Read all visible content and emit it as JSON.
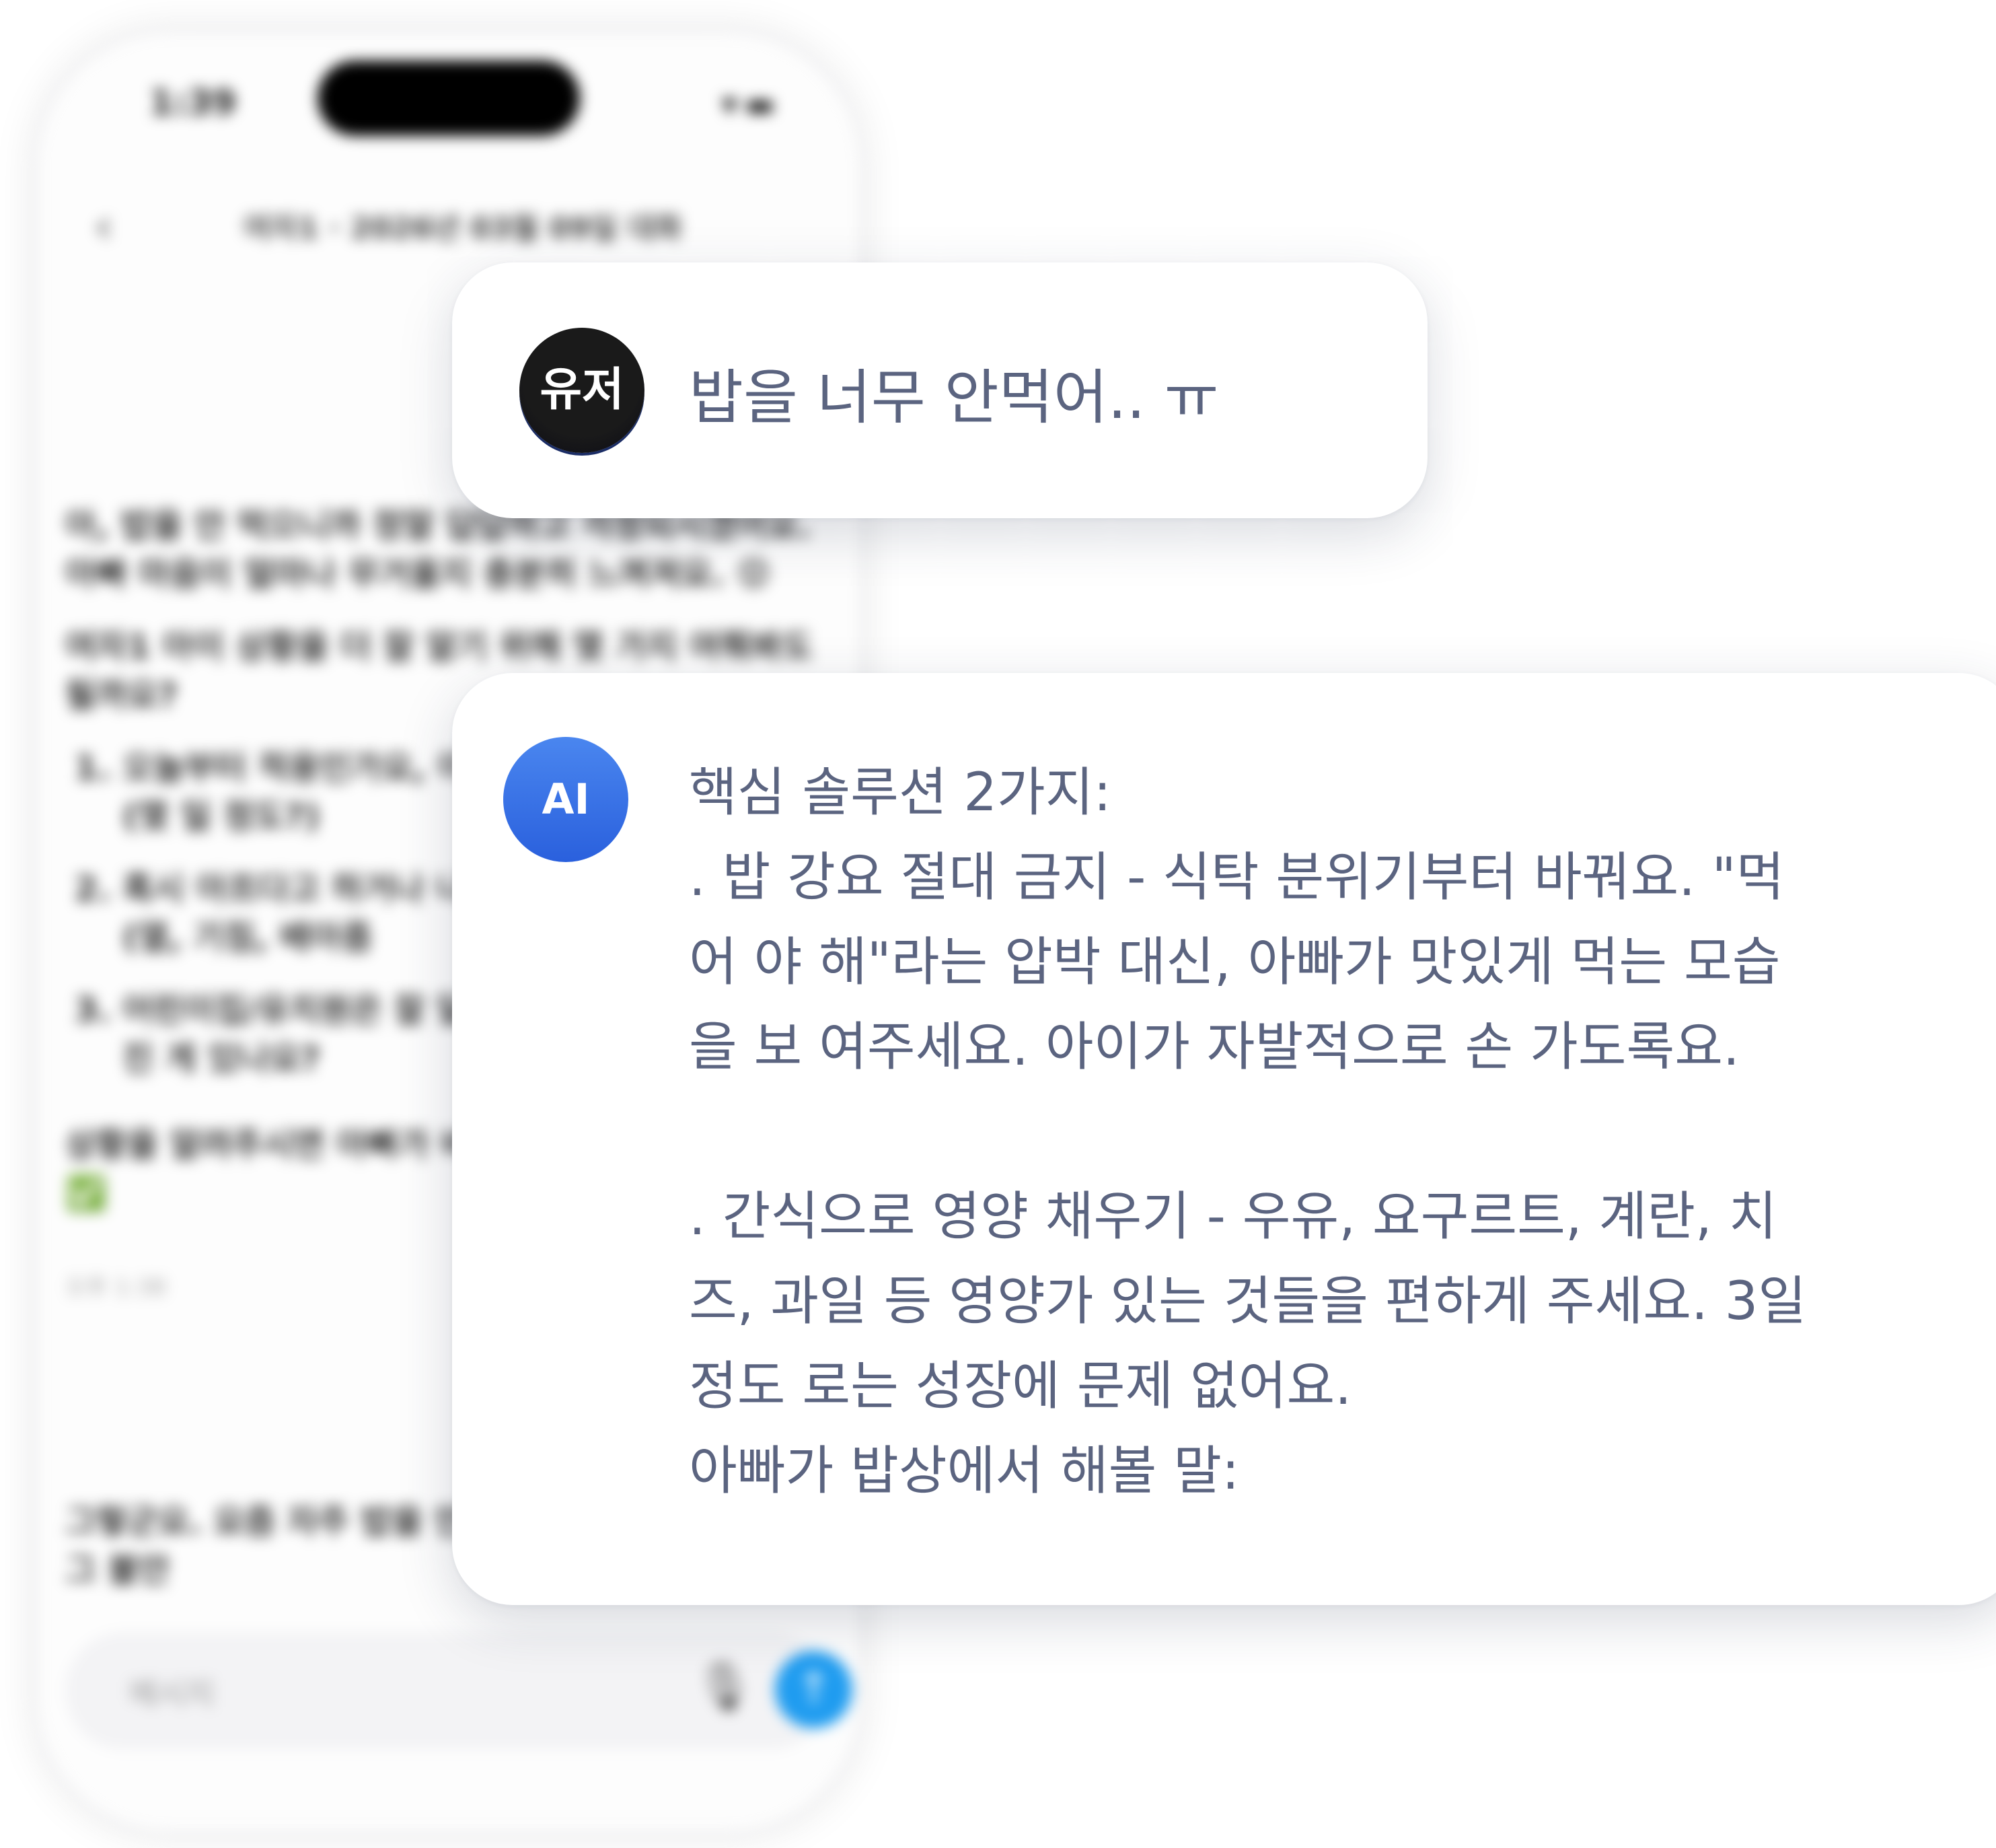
{
  "phone": {
    "status_time": "1:39",
    "chat_title": "여자1 · 2026년 03월 09일 대화",
    "bg_messages": [
      "아, 밥을 안 먹으니까 정말 답답하고 걱정되시겠어요. 아빠 마음이 얼마나 무거울지 충분히 느껴져요. 😟",
      "여자1 아이 상황을 더 잘 알기 위해 몇 가지 여쭤봐도 될까요?"
    ],
    "bg_list": [
      "오늘부터 적용인가요, 이 (몇 일 정도?)",
      "혹시 아프다고 하거나 나요? (열, 기침, 배아픔",
      "어린이집/유치원은 잘 달라진 게 있나요?"
    ],
    "bg_followup": "상황을 알려주시면 아빠가 바로 힘을 드릴 수 있어요! ✅",
    "bg_time": "오후 1:38",
    "bg_last": "그렇군요. 요즘 자주 밥을 안 먹어요. 아빠가 느끼는 그 불안",
    "input_placeholder": "메시지"
  },
  "user_message": {
    "avatar_label": "유저",
    "text": "밥을 너무 안먹어.. ㅠ"
  },
  "ai_message": {
    "avatar_label": "AI",
    "lines": [
      "핵심 솔루션 2가지:",
      ". 밥 강요 절대 금지 - 식탁 분위기부터 바꿔요. \"먹",
      "어 야 해\"라는 압박 대신, 아빠가 맛있게 먹는 모습",
      "을 보 여주세요. 아이가 자발적으로 손 가도록요.",
      "",
      ". 간식으로 영양 채우기 - 우유, 요구르트, 계란, 치",
      "즈, 과일 등 영양가 있는 것들을 편하게 주세요. 3일",
      "정도 로는 성장에 문제 없어요.",
      "아빠가 밥상에서 해볼 말:"
    ]
  }
}
